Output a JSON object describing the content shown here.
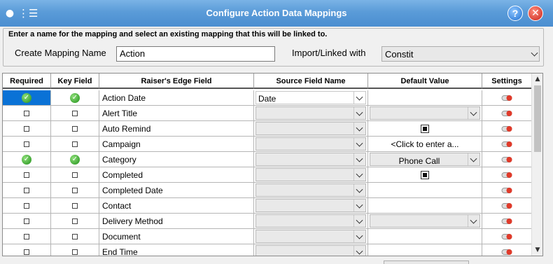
{
  "window": {
    "title": "Configure Action Data Mappings",
    "icons": [
      "map-pin-icon",
      "menu-list-icon",
      "help-icon",
      "close-icon"
    ],
    "accent": "#4b8ed0"
  },
  "form": {
    "legend": "Enter a name for the mapping and select an existing mapping that this will be linked to.",
    "name_label": "Create Mapping Name",
    "name_value": "Action",
    "link_label": "Import/Linked with",
    "link_value": "Constit"
  },
  "grid": {
    "headers": [
      "Required",
      "Key Field",
      "Raiser's Edge Field",
      "Source Field Name",
      "Default Value",
      "Settings"
    ],
    "rows": [
      {
        "required": true,
        "key": true,
        "field": "Action Date",
        "source": "Date",
        "default_type": "blank"
      },
      {
        "required": false,
        "key": false,
        "field": "Alert Title",
        "source": "",
        "default_type": "dropdown",
        "default": ""
      },
      {
        "required": false,
        "key": false,
        "field": "Auto Remind",
        "source": "",
        "default_type": "checkbox"
      },
      {
        "required": false,
        "key": false,
        "field": "Campaign",
        "source": "",
        "default_type": "text",
        "default": "<Click to enter a..."
      },
      {
        "required": true,
        "key": true,
        "field": "Category",
        "source": "",
        "default_type": "dropdown",
        "default": "Phone Call"
      },
      {
        "required": false,
        "key": false,
        "field": "Completed",
        "source": "",
        "default_type": "checkbox"
      },
      {
        "required": false,
        "key": false,
        "field": "Completed Date",
        "source": "",
        "default_type": "blank"
      },
      {
        "required": false,
        "key": false,
        "field": "Contact",
        "source": "",
        "default_type": "blank"
      },
      {
        "required": false,
        "key": false,
        "field": "Delivery Method",
        "source": "",
        "default_type": "dropdown",
        "default": ""
      },
      {
        "required": false,
        "key": false,
        "field": "Document",
        "source": "",
        "default_type": "blank"
      },
      {
        "required": false,
        "key": false,
        "field": "End Time",
        "source": "",
        "default_type": "blank"
      }
    ],
    "selected_row": 0
  }
}
